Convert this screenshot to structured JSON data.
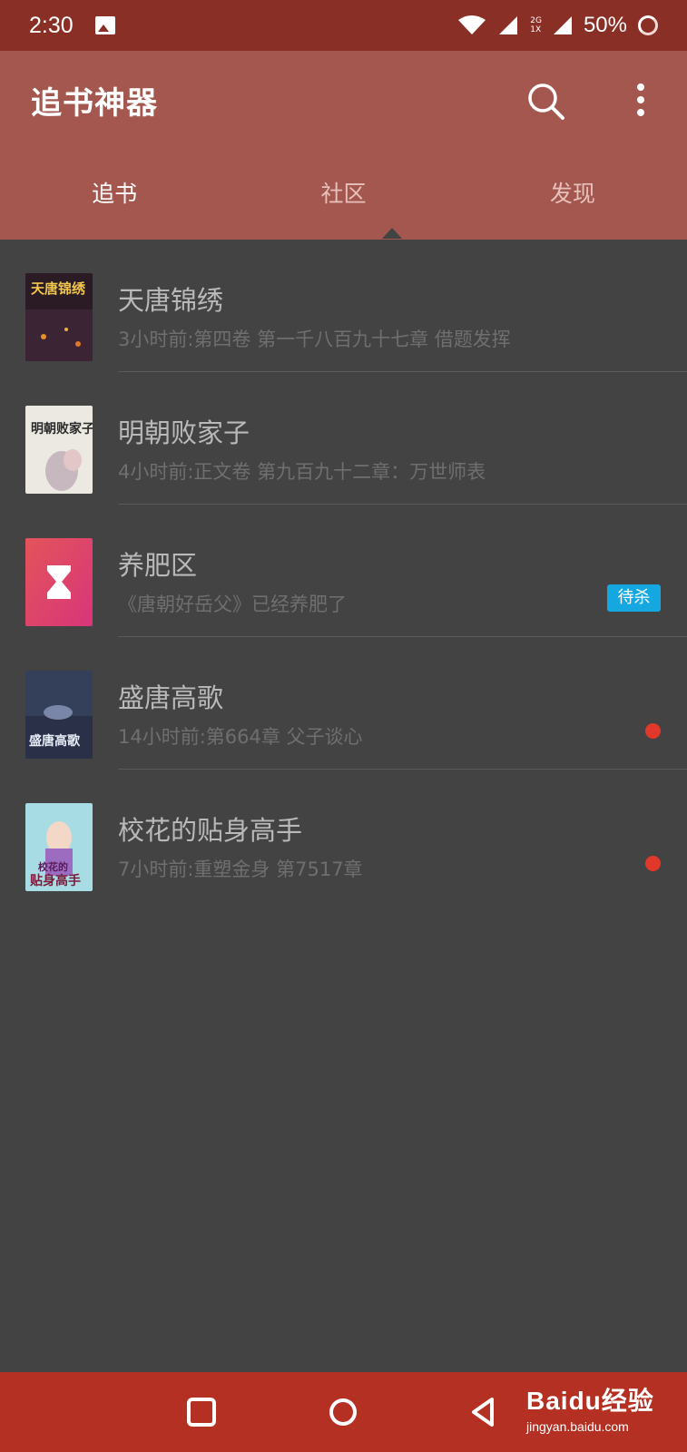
{
  "status": {
    "time": "2:30",
    "net_top": "2G",
    "net_bottom": "1X",
    "battery": "50%"
  },
  "app": {
    "title": "追书神器"
  },
  "tabs": [
    {
      "label": "追书",
      "active": true
    },
    {
      "label": "社区",
      "active": false
    },
    {
      "label": "发现",
      "active": false
    }
  ],
  "books": [
    {
      "title": "天唐锦绣",
      "subtitle": "3小时前:第四卷 第一千八百九十七章 借题发挥",
      "cover_text": "天唐锦绣"
    },
    {
      "title": "明朝败家子",
      "subtitle": "4小时前:正文卷 第九百九十二章：万世师表",
      "cover_text": "明朝败家子"
    },
    {
      "title": "养肥区",
      "subtitle": "《唐朝好岳父》已经养肥了",
      "badge": "待杀"
    },
    {
      "title": "盛唐高歌",
      "subtitle": "14小时前:第664章 父子谈心",
      "cover_text": "盛唐高歌"
    },
    {
      "title": "校花的贴身高手",
      "subtitle": "7小时前:重塑金身 第7517章",
      "cover_text": "校花的贴身高手"
    }
  ],
  "watermark": {
    "brand": "Baidu经验",
    "url": "jingyan.baidu.com"
  },
  "colors": {
    "status_bar": "#8a2f25",
    "app_bar": "#a3574e",
    "background": "#434343",
    "nav_bar": "#b43022",
    "badge": "#15a7e0",
    "unread_dot": "#e0382b"
  }
}
